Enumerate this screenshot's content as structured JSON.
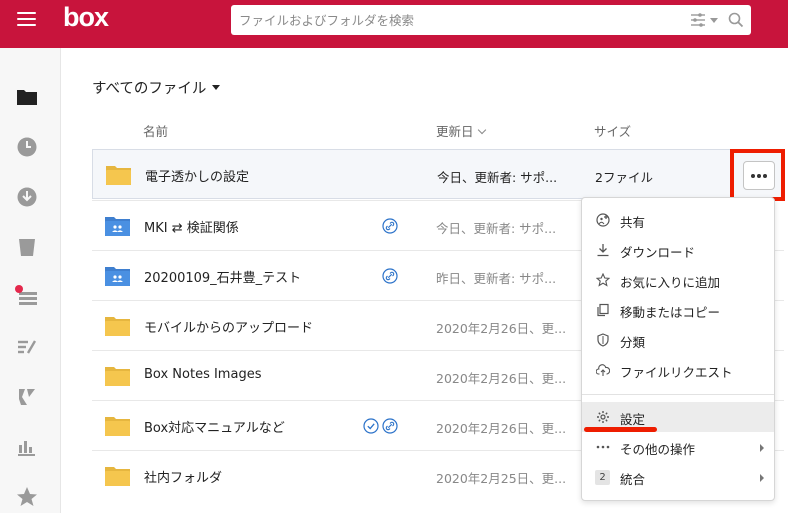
{
  "header": {
    "logo": "box",
    "search_placeholder": "ファイルおよびフォルダを検索",
    "brand_color": "#c8143c"
  },
  "sidebar": {
    "items": [
      {
        "icon": "folder-icon"
      },
      {
        "icon": "clock-icon"
      },
      {
        "icon": "download-icon"
      },
      {
        "icon": "trash-icon"
      },
      {
        "icon": "feed-icon",
        "has_notification": true
      },
      {
        "icon": "notes-icon"
      },
      {
        "icon": "relay-icon"
      },
      {
        "icon": "analytics-icon"
      },
      {
        "icon": "star-icon"
      }
    ]
  },
  "main": {
    "breadcrumb": "すべてのファイル",
    "columns": {
      "name": "名前",
      "updated": "更新日",
      "size": "サイズ"
    },
    "rows": [
      {
        "name": "電子透かしの設定",
        "updated": "今日、更新者: サポ...",
        "size": "2ファイル",
        "folder": "yellow",
        "selected": true
      },
      {
        "name": "MKI ⇄ 検証関係",
        "updated": "今日、更新者: サポ...",
        "size": "",
        "folder": "blue",
        "icons": [
          "link-icon"
        ]
      },
      {
        "name": "20200109_石井豊_テスト",
        "updated": "昨日、更新者: サポ...",
        "size": "",
        "folder": "blue",
        "icons": [
          "link-icon"
        ]
      },
      {
        "name": "モバイルからのアップロード",
        "updated": "2020年2月26日、更...",
        "size": "",
        "folder": "yellow"
      },
      {
        "name": "Box Notes Images",
        "updated": "2020年2月26日、更...",
        "size": "",
        "folder": "yellow"
      },
      {
        "name": "Box対応マニュアルなど",
        "updated": "2020年2月26日、更...",
        "size": "",
        "folder": "yellow",
        "icons": [
          "check-icon",
          "link-icon"
        ]
      },
      {
        "name": "社内フォルダ",
        "updated": "2020年2月25日、更...",
        "size": "",
        "folder": "yellow"
      }
    ]
  },
  "menu": {
    "items": [
      {
        "label": "共有",
        "icon": "share-icon"
      },
      {
        "label": "ダウンロード",
        "icon": "download-icon"
      },
      {
        "label": "お気に入りに追加",
        "icon": "star-icon"
      },
      {
        "label": "移動またはコピー",
        "icon": "copy-icon"
      },
      {
        "label": "分類",
        "icon": "shield-icon"
      },
      {
        "label": "ファイルリクエスト",
        "icon": "upload-icon"
      },
      {
        "label": "設定",
        "icon": "gear-icon",
        "highlighted": true
      },
      {
        "label": "その他の操作",
        "icon": "ellipsis-icon",
        "submenu": true
      },
      {
        "label": "統合",
        "badge": "2",
        "submenu": true
      }
    ]
  },
  "annotation_color": "#ee1d00"
}
